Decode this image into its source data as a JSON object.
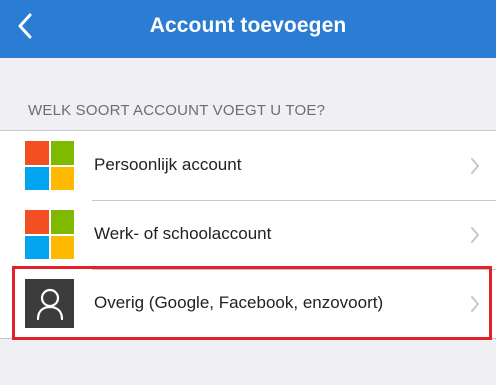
{
  "header": {
    "title": "Account toevoegen",
    "back_icon": "chevron-left-icon",
    "background": "#2b7cd3"
  },
  "section": {
    "title": "WELK SOORT ACCOUNT VOEGT U TOE?"
  },
  "accounts": [
    {
      "label": "Persoonlijk account",
      "icon": "microsoft-logo-icon"
    },
    {
      "label": "Werk- of schoolaccount",
      "icon": "microsoft-logo-icon"
    },
    {
      "label": "Overig (Google, Facebook, enzovoort)",
      "icon": "person-icon",
      "highlighted": true
    }
  ],
  "colors": {
    "highlight_border": "#e4202a",
    "ms_red": "#f25022",
    "ms_green": "#7fba00",
    "ms_blue": "#00a4ef",
    "ms_yellow": "#ffb900"
  }
}
